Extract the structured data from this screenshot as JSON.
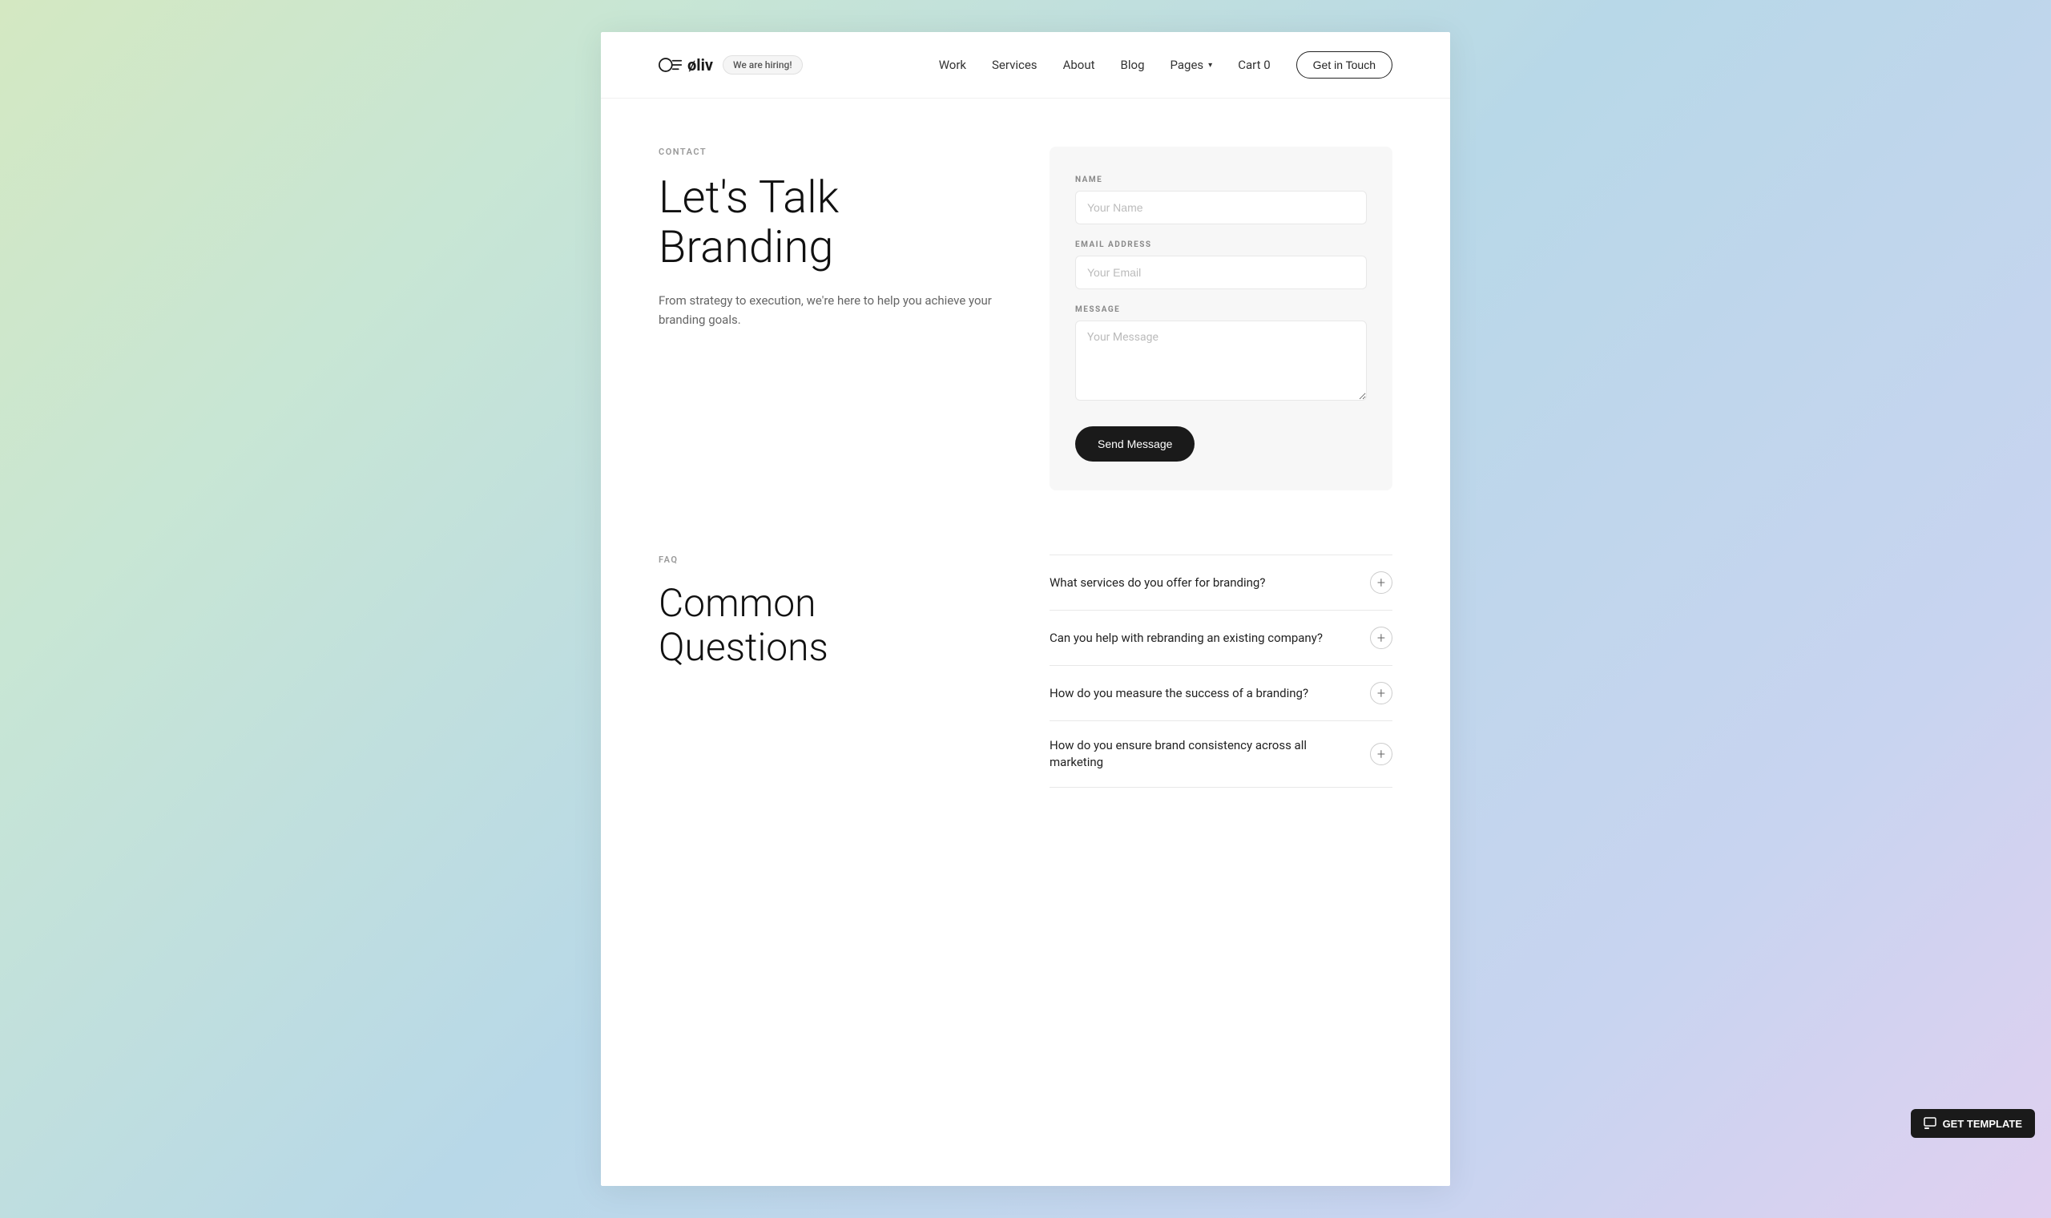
{
  "brand": {
    "logo_text": "øliv",
    "hiring_badge": "We are hiring!"
  },
  "nav": {
    "links": [
      {
        "label": "Work",
        "id": "work"
      },
      {
        "label": "Services",
        "id": "services"
      },
      {
        "label": "About",
        "id": "about"
      },
      {
        "label": "Blog",
        "id": "blog"
      },
      {
        "label": "Pages",
        "id": "pages"
      },
      {
        "label": "Cart  0",
        "id": "cart"
      }
    ],
    "cta": "Get in Touch"
  },
  "contact": {
    "label": "CONTACT",
    "heading_line1": "Let's Talk",
    "heading_line2": "Branding",
    "description": "From strategy to execution, we're here to help you achieve your branding goals.",
    "form": {
      "name_label": "NAME",
      "name_placeholder": "Your Name",
      "email_label": "EMAIL ADDRESS",
      "email_placeholder": "Your Email",
      "message_label": "MESSAGE",
      "message_placeholder": "Your Message",
      "submit_label": "Send Message"
    }
  },
  "faq": {
    "label": "FAQ",
    "heading_line1": "Common",
    "heading_line2": "Questions",
    "items": [
      {
        "question": "What services do you offer for branding?"
      },
      {
        "question": "Can you help with rebranding an existing company?"
      },
      {
        "question": "How do you measure the success of a branding?"
      },
      {
        "question": "How do you ensure brand consistency across all marketing"
      }
    ]
  },
  "get_template": {
    "label": "GET TEMPLATE"
  }
}
